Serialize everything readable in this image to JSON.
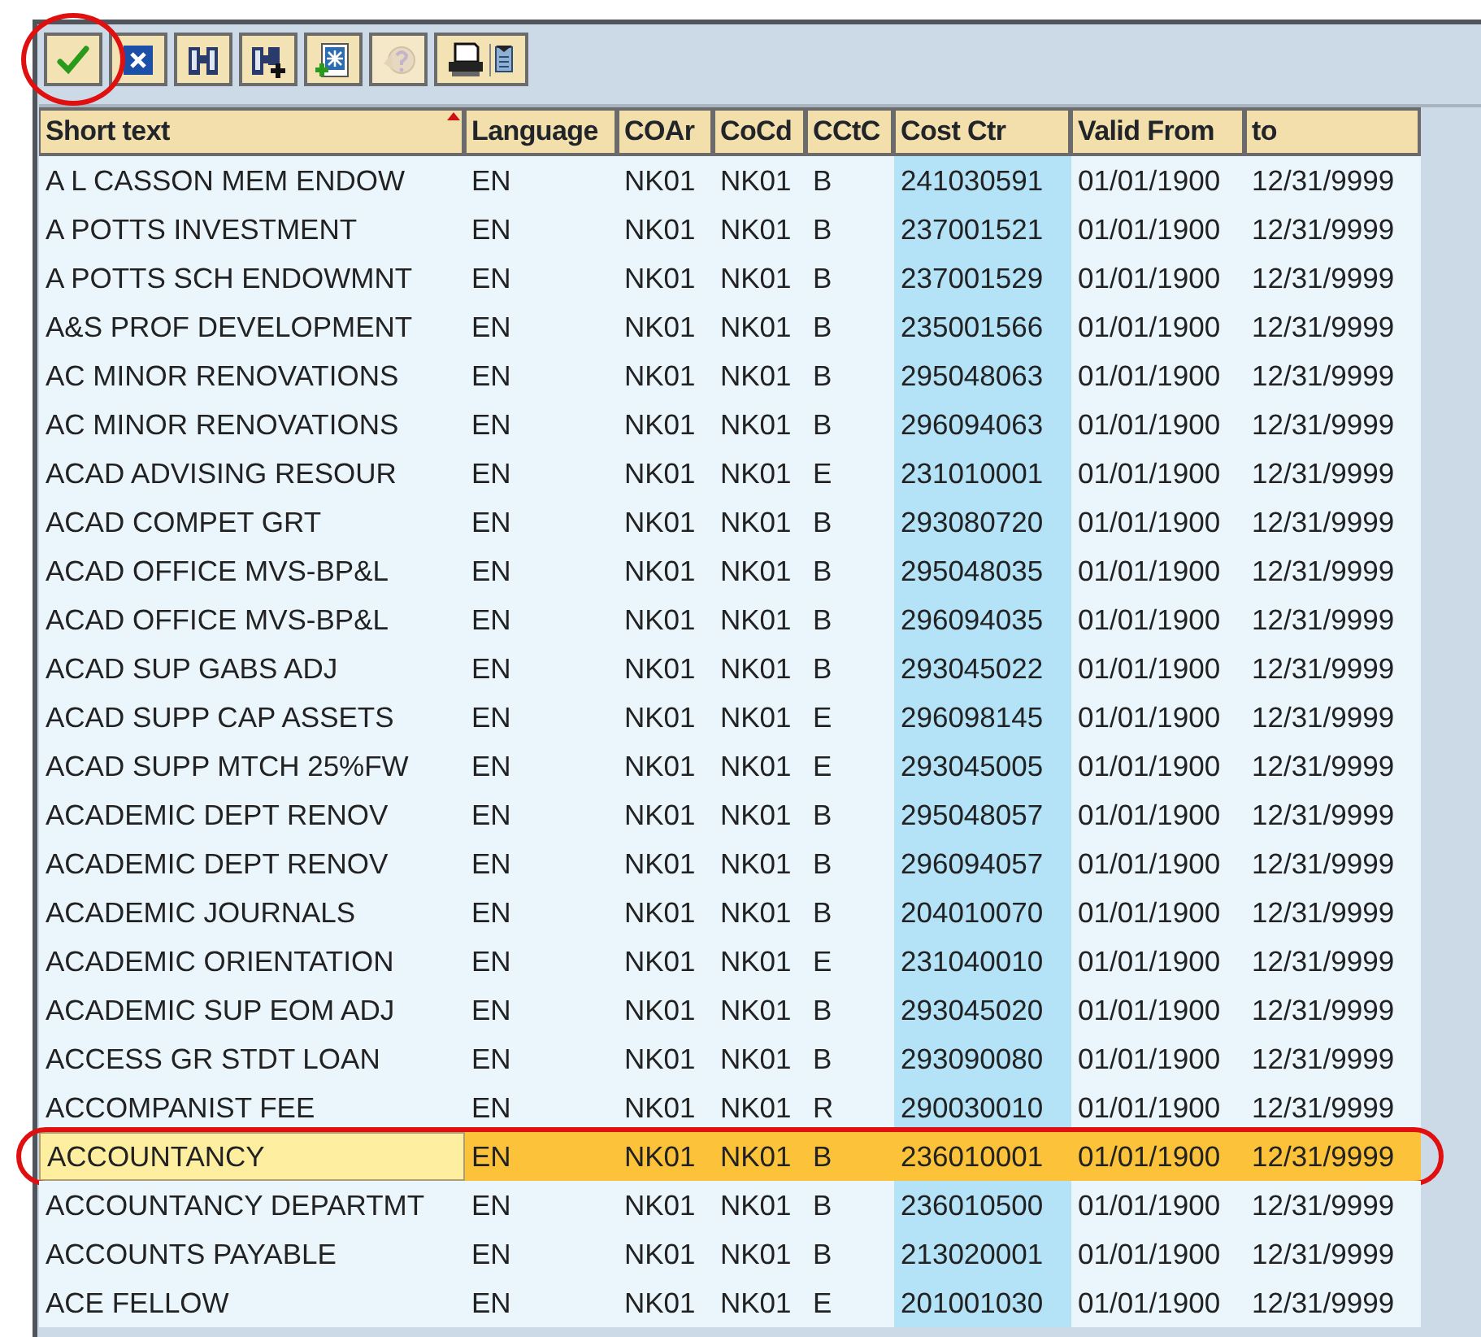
{
  "toolbar": [
    {
      "kind": "check",
      "disabled": false,
      "circled": true
    },
    {
      "kind": "cancel",
      "disabled": false,
      "circled": false
    },
    {
      "kind": "find",
      "disabled": false,
      "circled": false
    },
    {
      "kind": "find-next",
      "disabled": false,
      "circled": false
    },
    {
      "kind": "new-entry",
      "disabled": false,
      "circled": false
    },
    {
      "kind": "help",
      "disabled": true,
      "circled": false
    },
    {
      "kind": "print",
      "disabled": false,
      "circled": false
    }
  ],
  "columns": [
    {
      "label": "Short text",
      "sorted": true
    },
    {
      "label": "Language",
      "sorted": false
    },
    {
      "label": "COAr",
      "sorted": false
    },
    {
      "label": "CoCd",
      "sorted": false
    },
    {
      "label": "CCtC",
      "sorted": false
    },
    {
      "label": "Cost Ctr",
      "sorted": false
    },
    {
      "label": "Valid From",
      "sorted": false
    },
    {
      "label": "to",
      "sorted": false
    }
  ],
  "rows": [
    {
      "cells": [
        "A L CASSON MEM ENDOW",
        "EN",
        "NK01",
        "NK01",
        "B",
        "241030591",
        "01/01/1900",
        "12/31/9999"
      ],
      "selected": false,
      "circled": false
    },
    {
      "cells": [
        "A POTTS INVESTMENT",
        "EN",
        "NK01",
        "NK01",
        "B",
        "237001521",
        "01/01/1900",
        "12/31/9999"
      ],
      "selected": false,
      "circled": false
    },
    {
      "cells": [
        "A POTTS SCH ENDOWMNT",
        "EN",
        "NK01",
        "NK01",
        "B",
        "237001529",
        "01/01/1900",
        "12/31/9999"
      ],
      "selected": false,
      "circled": false
    },
    {
      "cells": [
        "A&S PROF DEVELOPMENT",
        "EN",
        "NK01",
        "NK01",
        "B",
        "235001566",
        "01/01/1900",
        "12/31/9999"
      ],
      "selected": false,
      "circled": false
    },
    {
      "cells": [
        "AC MINOR RENOVATIONS",
        "EN",
        "NK01",
        "NK01",
        "B",
        "295048063",
        "01/01/1900",
        "12/31/9999"
      ],
      "selected": false,
      "circled": false
    },
    {
      "cells": [
        "AC MINOR RENOVATIONS",
        "EN",
        "NK01",
        "NK01",
        "B",
        "296094063",
        "01/01/1900",
        "12/31/9999"
      ],
      "selected": false,
      "circled": false
    },
    {
      "cells": [
        "ACAD ADVISING RESOUR",
        "EN",
        "NK01",
        "NK01",
        "E",
        "231010001",
        "01/01/1900",
        "12/31/9999"
      ],
      "selected": false,
      "circled": false
    },
    {
      "cells": [
        "ACAD COMPET GRT",
        "EN",
        "NK01",
        "NK01",
        "B",
        "293080720",
        "01/01/1900",
        "12/31/9999"
      ],
      "selected": false,
      "circled": false
    },
    {
      "cells": [
        "ACAD OFFICE MVS-BP&L",
        "EN",
        "NK01",
        "NK01",
        "B",
        "295048035",
        "01/01/1900",
        "12/31/9999"
      ],
      "selected": false,
      "circled": false
    },
    {
      "cells": [
        "ACAD OFFICE MVS-BP&L",
        "EN",
        "NK01",
        "NK01",
        "B",
        "296094035",
        "01/01/1900",
        "12/31/9999"
      ],
      "selected": false,
      "circled": false
    },
    {
      "cells": [
        "ACAD SUP GABS ADJ",
        "EN",
        "NK01",
        "NK01",
        "B",
        "293045022",
        "01/01/1900",
        "12/31/9999"
      ],
      "selected": false,
      "circled": false
    },
    {
      "cells": [
        "ACAD SUPP CAP ASSETS",
        "EN",
        "NK01",
        "NK01",
        "E",
        "296098145",
        "01/01/1900",
        "12/31/9999"
      ],
      "selected": false,
      "circled": false
    },
    {
      "cells": [
        "ACAD SUPP MTCH 25%FW",
        "EN",
        "NK01",
        "NK01",
        "E",
        "293045005",
        "01/01/1900",
        "12/31/9999"
      ],
      "selected": false,
      "circled": false
    },
    {
      "cells": [
        "ACADEMIC DEPT RENOV",
        "EN",
        "NK01",
        "NK01",
        "B",
        "295048057",
        "01/01/1900",
        "12/31/9999"
      ],
      "selected": false,
      "circled": false
    },
    {
      "cells": [
        "ACADEMIC DEPT RENOV",
        "EN",
        "NK01",
        "NK01",
        "B",
        "296094057",
        "01/01/1900",
        "12/31/9999"
      ],
      "selected": false,
      "circled": false
    },
    {
      "cells": [
        "ACADEMIC JOURNALS",
        "EN",
        "NK01",
        "NK01",
        "B",
        "204010070",
        "01/01/1900",
        "12/31/9999"
      ],
      "selected": false,
      "circled": false
    },
    {
      "cells": [
        "ACADEMIC ORIENTATION",
        "EN",
        "NK01",
        "NK01",
        "E",
        "231040010",
        "01/01/1900",
        "12/31/9999"
      ],
      "selected": false,
      "circled": false
    },
    {
      "cells": [
        "ACADEMIC SUP EOM ADJ",
        "EN",
        "NK01",
        "NK01",
        "B",
        "293045020",
        "01/01/1900",
        "12/31/9999"
      ],
      "selected": false,
      "circled": false
    },
    {
      "cells": [
        "ACCESS GR STDT LOAN",
        "EN",
        "NK01",
        "NK01",
        "B",
        "293090080",
        "01/01/1900",
        "12/31/9999"
      ],
      "selected": false,
      "circled": false
    },
    {
      "cells": [
        "ACCOMPANIST FEE",
        "EN",
        "NK01",
        "NK01",
        "R",
        "290030010",
        "01/01/1900",
        "12/31/9999"
      ],
      "selected": false,
      "circled": false
    },
    {
      "cells": [
        "ACCOUNTANCY",
        "EN",
        "NK01",
        "NK01",
        "B",
        "236010001",
        "01/01/1900",
        "12/31/9999"
      ],
      "selected": true,
      "circled": true
    },
    {
      "cells": [
        "ACCOUNTANCY DEPARTMT",
        "EN",
        "NK01",
        "NK01",
        "B",
        "236010500",
        "01/01/1900",
        "12/31/9999"
      ],
      "selected": false,
      "circled": false
    },
    {
      "cells": [
        "ACCOUNTS PAYABLE",
        "EN",
        "NK01",
        "NK01",
        "B",
        "213020001",
        "01/01/1900",
        "12/31/9999"
      ],
      "selected": false,
      "circled": false
    },
    {
      "cells": [
        "ACE FELLOW",
        "EN",
        "NK01",
        "NK01",
        "E",
        "201001030",
        "01/01/1900",
        "12/31/9999"
      ],
      "selected": false,
      "circled": false
    }
  ]
}
